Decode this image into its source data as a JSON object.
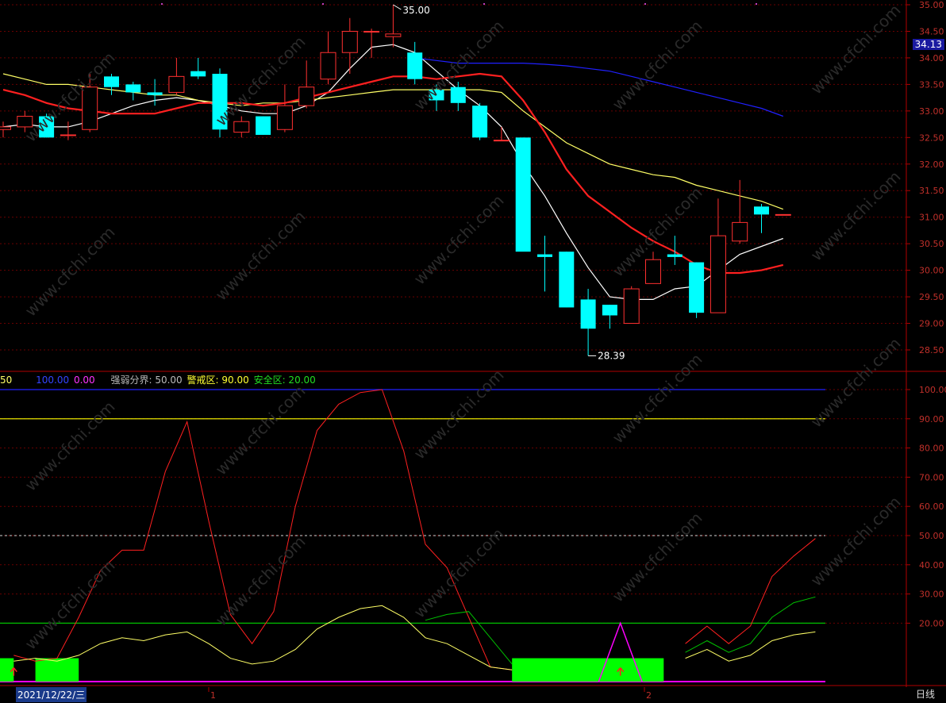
{
  "chart_data": [
    {
      "type": "candlestick",
      "ylim": [
        28.2,
        35.1
      ],
      "y_ticks": [
        "35.00",
        "34.50",
        "34.00",
        "33.50",
        "33.00",
        "32.50",
        "32.00",
        "31.50",
        "31.00",
        "30.50",
        "30.00",
        "29.50",
        "29.00",
        "28.50"
      ],
      "candles": [
        {
          "o": 32.65,
          "h": 32.8,
          "l": 32.5,
          "c": 32.7
        },
        {
          "o": 32.7,
          "h": 33.0,
          "l": 32.6,
          "c": 32.9
        },
        {
          "o": 32.9,
          "h": 32.95,
          "l": 32.5,
          "c": 32.5
        },
        {
          "o": 32.55,
          "h": 32.8,
          "l": 32.45,
          "c": 32.55
        },
        {
          "o": 32.65,
          "h": 33.7,
          "l": 32.6,
          "c": 33.45
        },
        {
          "o": 33.65,
          "h": 33.7,
          "l": 33.3,
          "c": 33.45
        },
        {
          "o": 33.5,
          "h": 33.55,
          "l": 33.2,
          "c": 33.35
        },
        {
          "o": 33.35,
          "h": 33.6,
          "l": 33.1,
          "c": 33.3
        },
        {
          "o": 33.35,
          "h": 34.0,
          "l": 33.3,
          "c": 33.65
        },
        {
          "o": 33.75,
          "h": 34.0,
          "l": 33.6,
          "c": 33.65
        },
        {
          "o": 33.7,
          "h": 33.8,
          "l": 32.5,
          "c": 32.65
        },
        {
          "o": 32.6,
          "h": 32.9,
          "l": 32.5,
          "c": 32.8
        },
        {
          "o": 32.9,
          "h": 32.9,
          "l": 32.55,
          "c": 32.55
        },
        {
          "o": 32.65,
          "h": 33.5,
          "l": 32.6,
          "c": 33.1
        },
        {
          "o": 33.1,
          "h": 33.95,
          "l": 33.05,
          "c": 33.45
        },
        {
          "o": 33.6,
          "h": 34.5,
          "l": 33.5,
          "c": 34.1
        },
        {
          "o": 34.1,
          "h": 34.75,
          "l": 33.7,
          "c": 34.5
        },
        {
          "o": 34.5,
          "h": 34.55,
          "l": 34.0,
          "c": 34.5
        },
        {
          "o": 34.4,
          "h": 35.0,
          "l": 34.2,
          "c": 34.45
        },
        {
          "o": 34.1,
          "h": 34.3,
          "l": 33.5,
          "c": 33.6
        },
        {
          "o": 33.4,
          "h": 33.5,
          "l": 33.0,
          "c": 33.2
        },
        {
          "o": 33.45,
          "h": 33.55,
          "l": 33.0,
          "c": 33.15
        },
        {
          "o": 33.1,
          "h": 33.15,
          "l": 32.45,
          "c": 32.5
        },
        {
          "o": 32.45,
          "h": 32.7,
          "l": 32.45,
          "c": 32.45
        },
        {
          "o": 32.5,
          "h": 32.5,
          "l": 31.2,
          "c": 30.35
        },
        {
          "o": 30.3,
          "h": 30.65,
          "l": 29.6,
          "c": 30.25
        },
        {
          "o": 30.35,
          "h": 30.35,
          "l": 29.3,
          "c": 29.3
        },
        {
          "o": 29.45,
          "h": 29.65,
          "l": 28.39,
          "c": 28.9
        },
        {
          "o": 29.35,
          "h": 29.35,
          "l": 28.9,
          "c": 29.15
        },
        {
          "o": 29.0,
          "h": 29.7,
          "l": 29.0,
          "c": 29.65
        },
        {
          "o": 29.75,
          "h": 30.35,
          "l": 29.75,
          "c": 30.2
        },
        {
          "o": 30.3,
          "h": 30.65,
          "l": 30.1,
          "c": 30.25
        },
        {
          "o": 30.15,
          "h": 30.15,
          "l": 29.1,
          "c": 29.2
        },
        {
          "o": 29.2,
          "h": 31.35,
          "l": 29.2,
          "c": 30.65
        },
        {
          "o": 30.55,
          "h": 31.7,
          "l": 30.5,
          "c": 30.9
        },
        {
          "o": 31.2,
          "h": 31.25,
          "l": 30.7,
          "c": 31.05
        },
        {
          "o": 31.05,
          "h": 31.05,
          "l": 31.05,
          "c": 31.05
        }
      ],
      "high_label": "35.00",
      "low_label": "28.39",
      "current_price": "34.13",
      "ma_lines": [
        {
          "color": "#ffffff",
          "values": [
            32.7,
            32.75,
            32.7,
            32.7,
            32.8,
            32.95,
            33.1,
            33.2,
            33.25,
            33.2,
            33.1,
            33.0,
            32.95,
            32.95,
            33.1,
            33.35,
            33.8,
            34.2,
            34.25,
            34.1,
            33.75,
            33.4,
            33.1,
            32.7,
            32.0,
            31.4,
            30.7,
            30.05,
            29.5,
            29.45,
            29.45,
            29.65,
            29.7,
            30.0,
            30.3,
            30.45,
            30.6
          ]
        },
        {
          "color": "#ffff66",
          "values": [
            33.7,
            33.6,
            33.5,
            33.5,
            33.45,
            33.4,
            33.35,
            33.3,
            33.3,
            33.2,
            33.15,
            33.1,
            33.15,
            33.15,
            33.2,
            33.25,
            33.3,
            33.35,
            33.4,
            33.4,
            33.4,
            33.4,
            33.4,
            33.35,
            33.0,
            32.7,
            32.4,
            32.2,
            32.0,
            31.9,
            31.8,
            31.75,
            31.6,
            31.5,
            31.4,
            31.3,
            31.15
          ]
        },
        {
          "color": "#ff2020",
          "values": [
            33.4,
            33.3,
            33.15,
            33.05,
            33.0,
            32.95,
            32.95,
            32.95,
            33.05,
            33.15,
            33.15,
            33.15,
            33.1,
            33.15,
            33.25,
            33.35,
            33.45,
            33.55,
            33.65,
            33.65,
            33.6,
            33.65,
            33.7,
            33.65,
            33.2,
            32.6,
            31.9,
            31.4,
            31.1,
            30.8,
            30.55,
            30.35,
            30.1,
            29.95,
            29.95,
            30.0,
            30.1
          ]
        },
        {
          "color": "#2020ff",
          "values": [
            null,
            null,
            null,
            null,
            null,
            null,
            null,
            null,
            null,
            null,
            null,
            null,
            null,
            null,
            null,
            null,
            null,
            null,
            null,
            34.0,
            33.95,
            33.9,
            33.9,
            33.9,
            33.9,
            33.88,
            33.85,
            33.8,
            33.75,
            33.65,
            33.55,
            33.45,
            33.35,
            33.25,
            33.15,
            33.05,
            32.9
          ]
        }
      ]
    },
    {
      "type": "line",
      "ylim": [
        0,
        103
      ],
      "y_ticks": [
        "100.00",
        "90.00",
        "80.00",
        "70.00",
        "60.00",
        "50.00",
        "40.00",
        "30.00",
        "20.00"
      ],
      "header": {
        "item0": "50",
        "item1": "100.00",
        "item2": "0.00",
        "item3": "强弱分界: 50.00",
        "item4": "警戒区: 90.00",
        "item5": "安全区: 20.00"
      },
      "ref_lines": [
        {
          "value": 100,
          "color": "#2020ff"
        },
        {
          "value": 90,
          "color": "#ffff00"
        },
        {
          "value": 50,
          "color": "#aaaaaa",
          "dashed": true
        },
        {
          "value": 20,
          "color": "#00c000"
        },
        {
          "value": 0,
          "color": "#ff00ff"
        }
      ],
      "series": [
        {
          "color": "#ff2020",
          "values": [
            null,
            9,
            7,
            8,
            22,
            38,
            45,
            45,
            72,
            89,
            55,
            23,
            13,
            24,
            60,
            86,
            95,
            99,
            100,
            79,
            47,
            39,
            22,
            5,
            4,
            null,
            null,
            null,
            null,
            null,
            null,
            null,
            13,
            19,
            13,
            19,
            36,
            43,
            49
          ]
        },
        {
          "color": "#00c000",
          "values": [
            null,
            null,
            null,
            null,
            null,
            null,
            null,
            null,
            null,
            null,
            null,
            null,
            null,
            null,
            null,
            null,
            null,
            null,
            null,
            null,
            21,
            23,
            24,
            15,
            6,
            null,
            null,
            null,
            null,
            null,
            null,
            null,
            10,
            14,
            10,
            13,
            22,
            27,
            29
          ]
        },
        {
          "color": "#ffff66",
          "values": [
            null,
            7,
            8,
            7,
            9,
            13,
            15,
            14,
            16,
            17,
            13,
            8,
            6,
            7,
            11,
            18,
            22,
            25,
            26,
            22,
            15,
            13,
            9,
            5,
            4,
            null,
            null,
            null,
            null,
            null,
            null,
            null,
            8,
            11,
            7,
            9,
            14,
            16,
            17
          ]
        }
      ],
      "green_blocks": [
        [
          0,
          1
        ],
        [
          2,
          4
        ],
        [
          24,
          31
        ]
      ],
      "triangle": {
        "peak": 29,
        "value": 20
      },
      "arrows": [
        1,
        29
      ]
    }
  ],
  "x_axis": {
    "date_label": "2021/12/22/三",
    "ticks": [
      {
        "label": "1"
      },
      {
        "label": "2"
      }
    ],
    "period": "日线"
  },
  "watermark": "www.cfchi.com"
}
